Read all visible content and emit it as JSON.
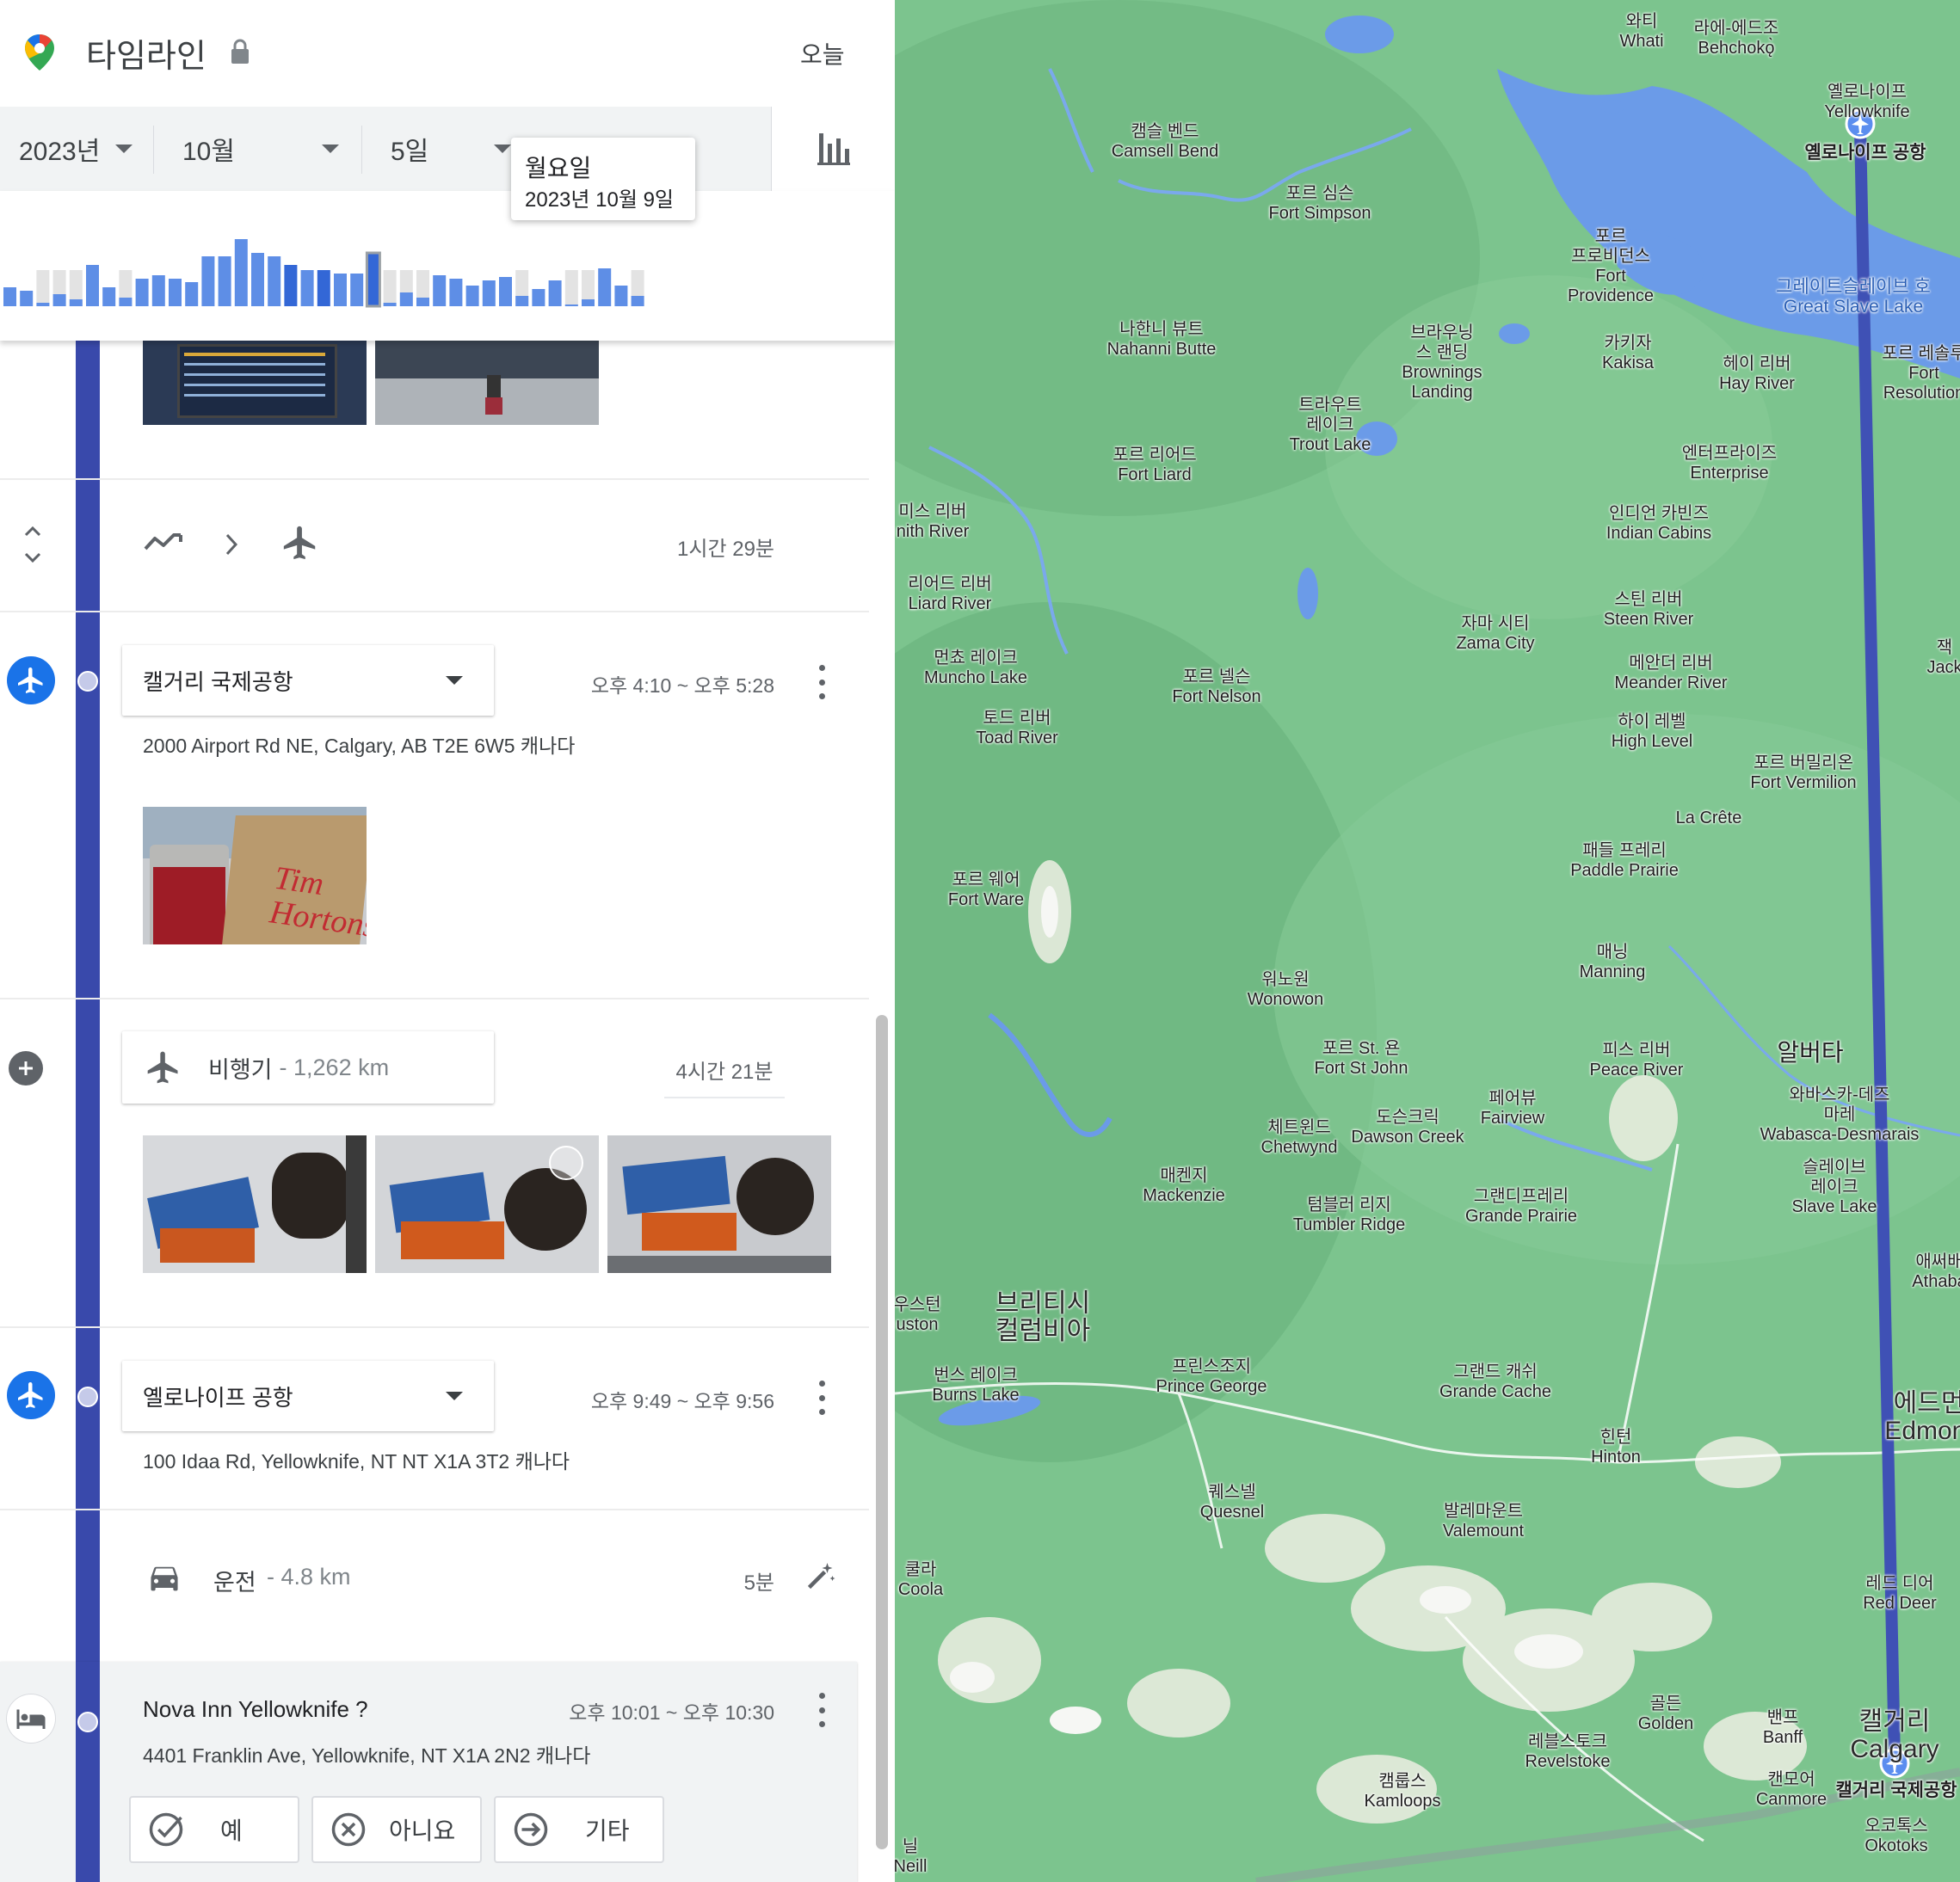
{
  "header": {
    "title": "타임라인",
    "today_label": "오늘"
  },
  "date_selector": {
    "year": "2023년",
    "month": "10월",
    "day": "5일"
  },
  "tooltip": {
    "weekday": "월요일",
    "date": "2023년 10월 9일"
  },
  "histogram": {
    "values": [
      22,
      18,
      4,
      14,
      8,
      48,
      22,
      10,
      32,
      36,
      32,
      28,
      58,
      58,
      78,
      62,
      58,
      48,
      42,
      42,
      38,
      38,
      62,
      4,
      16,
      10,
      36,
      32,
      24,
      30,
      34,
      12,
      20,
      30,
      0,
      8,
      44,
      24,
      12
    ]
  },
  "segments": {
    "transition": {
      "duration": "1시간 29분"
    },
    "calgary": {
      "place": "캘거리 국제공항",
      "time": "오후 4:10 ~ 오후 5:28",
      "address": "2000 Airport Rd NE, Calgary, AB T2E 6W5 캐나다"
    },
    "flight": {
      "mode": "비행기",
      "distance": "- 1,262 km",
      "duration": "4시간 21분"
    },
    "yellowknife": {
      "place": "옐로나이프 공항",
      "time": "오후 9:49 ~ 오후 9:56",
      "address": "100 Idaa Rd, Yellowknife, NT NT X1A 3T2 캐나다"
    },
    "drive": {
      "mode": "운전",
      "distance": "- 4.8 km",
      "duration": "5분"
    },
    "hotel": {
      "place": "Nova Inn Yellowknife ?",
      "time": "오후 10:01 ~ 오후 10:30",
      "address": "4401 Franklin Ave, Yellowknife, NT X1A 2N2 캐나다"
    }
  },
  "confirm_buttons": {
    "yes": "예",
    "no": "아니요",
    "other": "기타"
  },
  "photo_texts": {
    "cup_brand": "Tim Hortons"
  },
  "map_labels": [
    {
      "id": "whati",
      "text": "와티\nWhati"
    },
    {
      "id": "behchoko",
      "text": "라에-에드조\nBehchokǫ̀"
    },
    {
      "id": "yellowknife_city",
      "text": "옐로나이프\nYellowknife"
    },
    {
      "id": "yellowknife_airport",
      "text": "옐로나이프 공항"
    },
    {
      "id": "camsell",
      "text": "캠슬 벤드\nCamsell Bend"
    },
    {
      "id": "fort_simpson",
      "text": "포르 심슨\nFort Simpson"
    },
    {
      "id": "fort_providence",
      "text": "포르\n프로비던스\nFort\nProvidence"
    },
    {
      "id": "great_slave",
      "text": "그레이트슬레이브 호\nGreat Slave Lake"
    },
    {
      "id": "nahanni",
      "text": "나한니 뷰트\nNahanni Butte"
    },
    {
      "id": "brownings",
      "text": "브라우닝\n스 랜딩\nBrownings\nLanding"
    },
    {
      "id": "kakisa",
      "text": "카키자\nKakisa"
    },
    {
      "id": "hay_river",
      "text": "헤이 리버\nHay River"
    },
    {
      "id": "fort_resolution",
      "text": "포르 레솔루\nFort\nResolution"
    },
    {
      "id": "trout_lake",
      "text": "트라우트\n레이크\nTrout Lake"
    },
    {
      "id": "fort_liard",
      "text": "포르 리어드\nFort Liard"
    },
    {
      "id": "enterprise",
      "text": "엔터프라이즈\nEnterprise"
    },
    {
      "id": "smith_river",
      "text": "미스 리버\nnith River"
    },
    {
      "id": "indian_cabins",
      "text": "인디언 카빈즈\nIndian Cabins"
    },
    {
      "id": "liard_river",
      "text": "리어드 리버\nLiard River"
    },
    {
      "id": "steen_river",
      "text": "스틴 리버\nSteen River"
    },
    {
      "id": "zama",
      "text": "자마 시티\nZama City"
    },
    {
      "id": "muncho",
      "text": "먼쵸 레이크\nMuncho Lake"
    },
    {
      "id": "fort_nelson",
      "text": "포르 넬슨\nFort Nelson"
    },
    {
      "id": "meander",
      "text": "메안더 리버\nMeander River"
    },
    {
      "id": "jack",
      "text": "잭\nJack"
    },
    {
      "id": "toad_river",
      "text": "토드 리버\nToad River"
    },
    {
      "id": "high_level",
      "text": "하이 레벨\nHigh Level"
    },
    {
      "id": "fort_vermilion",
      "text": "포르 버밀리온\nFort Vermilion"
    },
    {
      "id": "la_crete",
      "text": "La Crête"
    },
    {
      "id": "paddle_prairie",
      "text": "패들 프레리\nPaddle Prairie"
    },
    {
      "id": "fort_ware",
      "text": "포르 웨어\nFort Ware"
    },
    {
      "id": "manning",
      "text": "매닝\nManning"
    },
    {
      "id": "wonowon",
      "text": "워노원\nWonowon"
    },
    {
      "id": "fort_st_john",
      "text": "포르 St. 욘\nFort St John"
    },
    {
      "id": "peace_river",
      "text": "피스 리버\nPeace River"
    },
    {
      "id": "alberta",
      "text": "알버타"
    },
    {
      "id": "wabasca",
      "text": "와바스카-데즈\n마레\nWabasca-Desmarais"
    },
    {
      "id": "fairview",
      "text": "페어뷰\nFairview"
    },
    {
      "id": "chetwynd",
      "text": "체트윈드\nChetwynd"
    },
    {
      "id": "dawson_creek",
      "text": "도슨크릭\nDawson Creek"
    },
    {
      "id": "slave_lake",
      "text": "슬레이브\n레이크\nSlave Lake"
    },
    {
      "id": "mackenzie",
      "text": "매켄지\nMackenzie"
    },
    {
      "id": "tumbler",
      "text": "텀블러 리지\nTumbler Ridge"
    },
    {
      "id": "grande_prairie",
      "text": "그랜디프레리\nGrande Prairie"
    },
    {
      "id": "athabasca",
      "text": "애써배\nAthaba"
    },
    {
      "id": "bc",
      "text": "브리티시\n컬럼비아"
    },
    {
      "id": "houston",
      "text": "우스턴\nuston"
    },
    {
      "id": "burns_lake",
      "text": "번스 레이크\nBurns Lake"
    },
    {
      "id": "prince_george",
      "text": "프린스조지\nPrince George"
    },
    {
      "id": "grande_cache",
      "text": "그랜드 캐쉬\nGrande Cache"
    },
    {
      "id": "edmonton",
      "text": "에드먼\nEdmont"
    },
    {
      "id": "hinton",
      "text": "힌턴\nHinton"
    },
    {
      "id": "quesnel",
      "text": "퀘스넬\nQuesnel"
    },
    {
      "id": "valemount",
      "text": "발레마운트\nValemount"
    },
    {
      "id": "red_deer",
      "text": "레드 디어\nRed Deer"
    },
    {
      "id": "bella_coola",
      "text": "쿨라\nCoola"
    },
    {
      "id": "golden",
      "text": "골든\nGolden"
    },
    {
      "id": "banff",
      "text": "밴프\nBanff"
    },
    {
      "id": "calgary_city",
      "text": "캘거리\nCalgary"
    },
    {
      "id": "revelstoke",
      "text": "레블스토크\nRevelstoke"
    },
    {
      "id": "canmore",
      "text": "캔모어\nCanmore"
    },
    {
      "id": "calgary_airport",
      "text": "캘거리 국제공항"
    },
    {
      "id": "kamloops",
      "text": "캠룹스\nKamloops"
    },
    {
      "id": "okotoks",
      "text": "오코톡스\nOkotoks"
    },
    {
      "id": "mcneill",
      "text": "닐\nNeill"
    }
  ],
  "colors": {
    "route": "#3f51b5",
    "rail": "#3949ab",
    "map_green": "#74be86",
    "water": "#6b9be8",
    "bar": "#5e8ee6",
    "bar_selected": "#3367d6"
  }
}
